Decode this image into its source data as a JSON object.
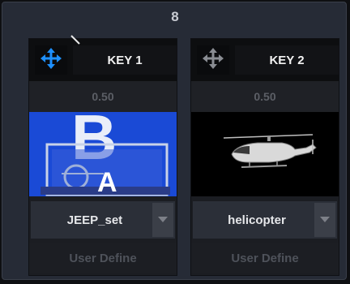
{
  "panel": {
    "number": "8"
  },
  "keys": [
    {
      "label": "KEY 1",
      "value": "0.50",
      "source_name": "JEEP_set",
      "user_define": "User Define",
      "thumb_letters": {
        "top": "B",
        "bottom": "A"
      },
      "move_icon_color": "#1e90ff",
      "active": true
    },
    {
      "label": "KEY 2",
      "value": "0.50",
      "source_name": "helicopter",
      "user_define": "User Define",
      "move_icon_color": "#8a8d93",
      "active": false
    }
  ],
  "icons": {
    "move": "four-way-arrow-icon",
    "dropdown": "chevron-down-icon",
    "resize": "resize-handle-icon"
  },
  "colors": {
    "accent": "#1e90ff",
    "panel_bg": "#262b36",
    "key_bg": "#1b1d22",
    "thumb_blue": "#1a4ad6"
  }
}
